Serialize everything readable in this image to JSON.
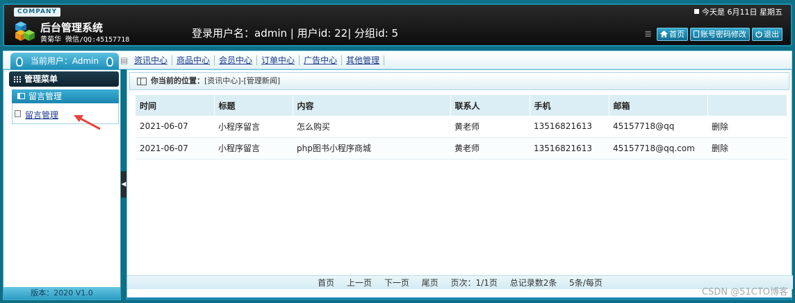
{
  "header": {
    "company": "COMPANY",
    "system_title": "后台管理系统",
    "system_sub": "黄菊华 微信/QQ:45157718",
    "login_info": "登录用户名：admin | 用户id: 22| 分组id: 5",
    "date_text": "今天是 6月11日  星期五",
    "buttons": {
      "home": "首页",
      "account": "账号密码修改",
      "logout": "退出"
    }
  },
  "nav": {
    "current_user": "当前用户：Admin",
    "items": [
      "资讯中心",
      "商品中心",
      "会员中心",
      "订单中心",
      "广告中心",
      "其他管理"
    ]
  },
  "sidebar": {
    "menu_title": "管理菜单",
    "section_title": "留言管理",
    "link": "留言管理",
    "version": "版本：2020 V1.0"
  },
  "main": {
    "location_label": "你当前的位置：",
    "location_path": "[资讯中心]-[管理新闻]",
    "table": {
      "headers": [
        "时间",
        "标题",
        "内容",
        "联系人",
        "手机",
        "邮箱",
        ""
      ],
      "rows": [
        [
          "2021-06-07",
          "小程序留言",
          "怎么购买",
          "黄老师",
          "13516821613",
          "45157718@qq",
          "删除"
        ],
        [
          "2021-06-07",
          "小程序留言",
          "php图书小程序商城",
          "黄老师",
          "13516821613",
          "45157718@qq.com",
          "删除"
        ]
      ]
    },
    "pager": {
      "first": "首页",
      "prev": "上一页",
      "next": "下一页",
      "last": "尾页",
      "page_info": "页次：1/1页",
      "total": "总记录数2条",
      "per_page": "5条/每页"
    }
  },
  "watermark": "CSDN @51CTO博客",
  "colors": {
    "accent": "#1b86b0",
    "header_bg": "#0d0d0d",
    "arrow": "#e8433a"
  }
}
